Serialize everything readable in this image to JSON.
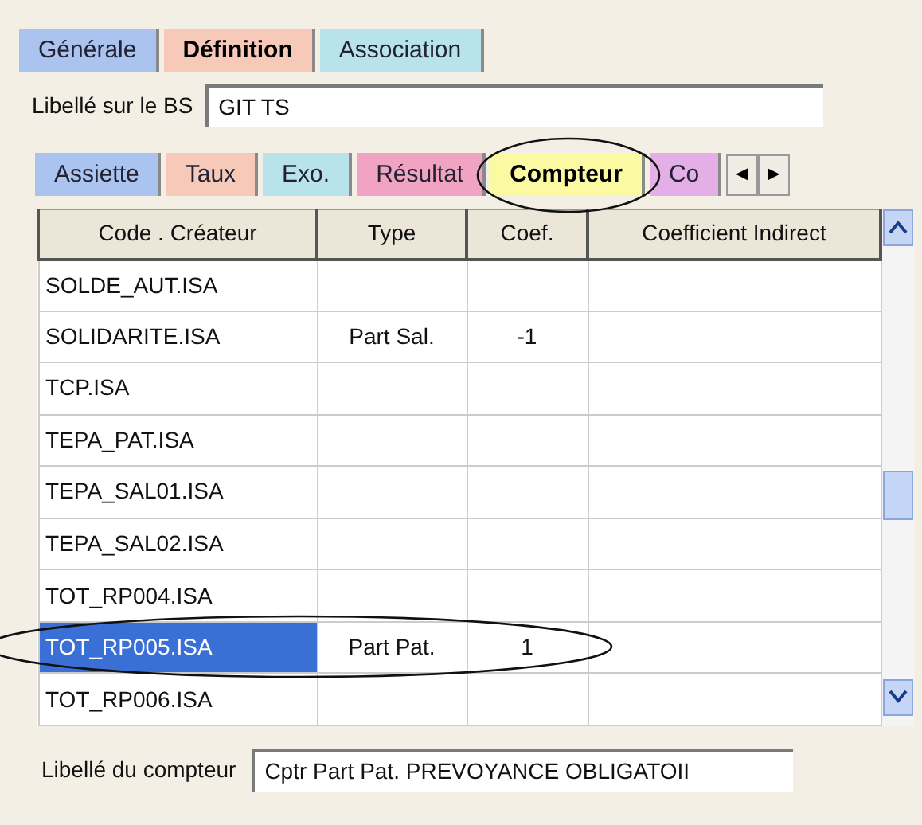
{
  "top_tabs": [
    {
      "label": "Générale",
      "selected": false,
      "color": "#aac4ef"
    },
    {
      "label": "Définition",
      "selected": true,
      "color": "#f6c9b9"
    },
    {
      "label": "Association",
      "selected": false,
      "color": "#b9e3ea"
    }
  ],
  "bs_label": {
    "label": "Libellé sur le BS",
    "value": "GIT  TS"
  },
  "sub_tabs": [
    {
      "label": "Assiette",
      "selected": false,
      "color": "#aac4ef"
    },
    {
      "label": "Taux",
      "selected": false,
      "color": "#f6c9b9"
    },
    {
      "label": "Exo.",
      "selected": false,
      "color": "#b9e3ea"
    },
    {
      "label": "Résultat",
      "selected": false,
      "color": "#f0a3c3"
    },
    {
      "label": "Compteur",
      "selected": true,
      "color": "#fbfaa2"
    },
    {
      "label": "Co",
      "selected": false,
      "color": "#e4aee6"
    }
  ],
  "tab_scroll": [
    "◀",
    "▶"
  ],
  "table": {
    "columns": [
      "Code . Créateur",
      "Type",
      "Coef.",
      "Coefficient Indirect"
    ],
    "rows": [
      {
        "code": "SOLDE_AUT.ISA",
        "selected": false
      },
      {
        "code": "SOLIDARITE.ISA",
        "type": "Part Sal.",
        "coef": "-1",
        "selected": false
      },
      {
        "code": "TCP.ISA",
        "selected": false
      },
      {
        "code": "TEPA_PAT.ISA",
        "selected": false
      },
      {
        "code": "TEPA_SAL01.ISA",
        "selected": false
      },
      {
        "code": "TEPA_SAL02.ISA",
        "selected": false
      },
      {
        "code": "TOT_RP004.ISA",
        "selected": false
      },
      {
        "code": "TOT_RP005.ISA",
        "type": "Part Pat.",
        "coef": "1",
        "selected": true
      },
      {
        "code": "TOT_RP006.ISA",
        "selected": false
      }
    ]
  },
  "counter_label": {
    "label": "Libellé du compteur",
    "value": "Cptr  Part Pat. PREVOYANCE OBLIGATOII"
  }
}
